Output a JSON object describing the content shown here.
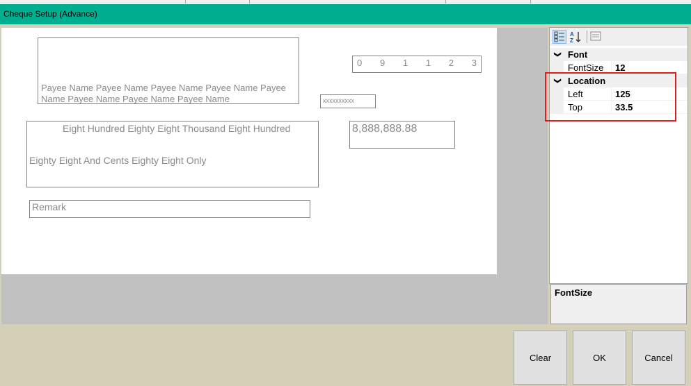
{
  "window": {
    "title": "Cheque Setup (Advance)"
  },
  "cheque": {
    "payee_text": "Payee Name Payee Name Payee Name Payee Name Payee Name Payee Name Payee Name Payee Name",
    "cheque_number_digits": [
      "0",
      "9",
      "1",
      "1",
      "2",
      "3"
    ],
    "date_placeholder": "xxxxxxxxxx",
    "amount_words_line1": "Eight Hundred Eighty Eight Thousand Eight Hundred",
    "amount_words_line2": "Eighty Eight And Cents Eighty Eight Only",
    "amount_figure": "8,888,888.88",
    "remark": "Remark"
  },
  "property_grid": {
    "toolbar": {
      "categorized_icon": "categorized-view-icon",
      "alphabetical_icon": "alphabetical-sort-icon",
      "property_pages_icon": "property-pages-icon"
    },
    "categories": [
      {
        "name": "Font",
        "properties": [
          {
            "name": "FontSize",
            "value": "12"
          }
        ]
      },
      {
        "name": "Location",
        "properties": [
          {
            "name": "Left",
            "value": "125"
          },
          {
            "name": "Top",
            "value": "33.5"
          }
        ]
      }
    ],
    "description_title": "FontSize",
    "highlight_color": "#e01b1b"
  },
  "buttons": {
    "clear": "Clear",
    "ok": "OK",
    "cancel": "Cancel"
  },
  "colors": {
    "titlebar": "#00af8f",
    "background": "#d4d0b8",
    "canvas": "#c0c0c0"
  }
}
